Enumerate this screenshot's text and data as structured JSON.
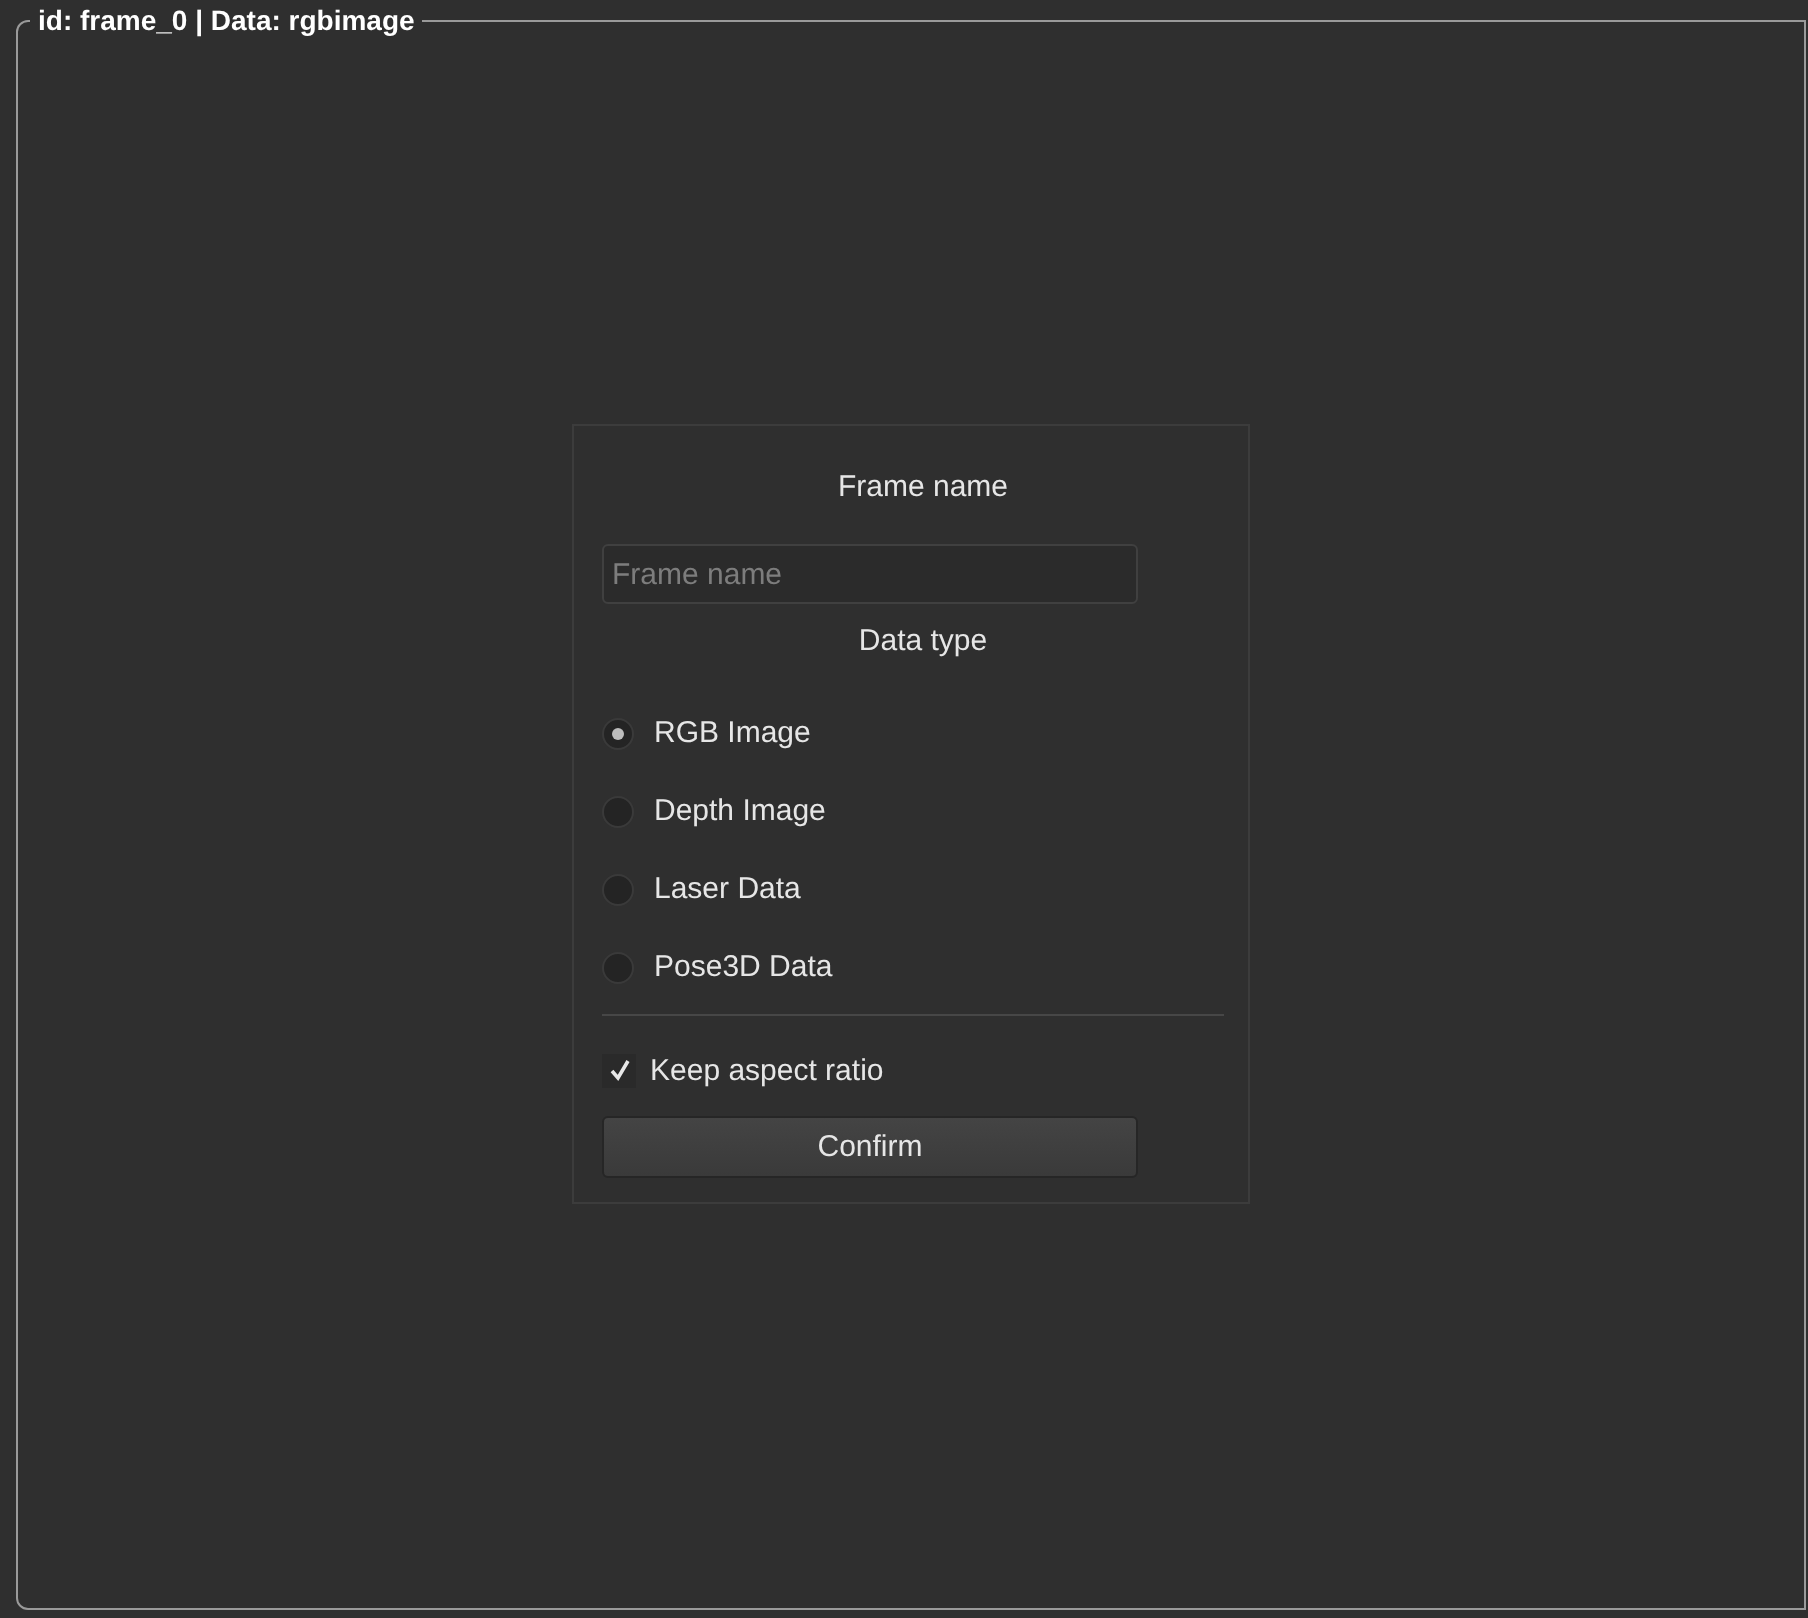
{
  "frame": {
    "title": "id:  frame_0 | Data:  rgbimage"
  },
  "form": {
    "name_label": "Frame name",
    "name_field": {
      "placeholder": "Frame name"
    },
    "type_label": "Data type",
    "data_types": [
      {
        "label": "RGB Image",
        "selected": true
      },
      {
        "label": "Depth Image",
        "selected": false
      },
      {
        "label": "Laser Data",
        "selected": false
      },
      {
        "label": "Pose3D Data",
        "selected": false
      }
    ],
    "keep_aspect": {
      "label": "Keep aspect ratio",
      "checked": true
    },
    "confirm_button": "Confirm"
  }
}
